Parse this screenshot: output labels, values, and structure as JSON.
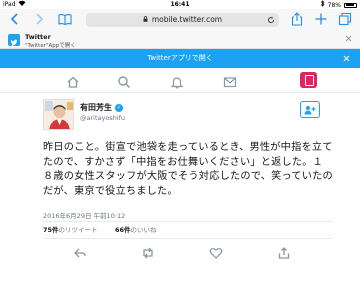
{
  "status_bar": {
    "device": "iPad",
    "time": "16:41",
    "battery_text": "78%"
  },
  "browser": {
    "url": "mobile.twitter.com"
  },
  "app_banner": {
    "title": "Twitter",
    "subtitle": "\"Twitter\"Appで開く"
  },
  "open_bar": {
    "label": "Twitterアプリで開く"
  },
  "tweet": {
    "display_name": "有田芳生",
    "handle": "@aritayoshifu",
    "text": "昨日のこと。街宣で池袋を走っているとき、男性が中指を立てたので、すかさず「中指をお仕舞いください」と返した。１８歳の女性スタッフが大阪でそう対応したので、笑っていたのだが、東京で役立ちました。",
    "timestamp": "2016年6月29日 午前10:12",
    "retweets_count": "75件",
    "retweets_label": "のリツイート",
    "likes_count": "66件",
    "likes_label": "のいいね"
  },
  "colors": {
    "twitter_blue": "#1da1f2",
    "tweet_button": "#e0245e",
    "muted": "#657786"
  }
}
